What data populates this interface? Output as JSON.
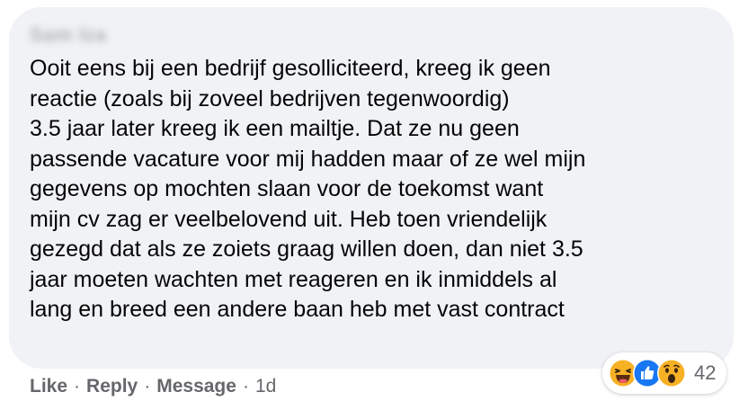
{
  "comment": {
    "author": "Sam Iza",
    "lines": [
      "Ooit eens bij een bedrijf gesolliciteerd, kreeg ik geen",
      "reactie (zoals bij zoveel bedrijven tegenwoordig)",
      "3.5 jaar later kreeg ik een mailtje. Dat ze nu geen",
      "passende vacature voor mij hadden maar of ze wel mijn",
      "gegevens op mochten slaan voor de toekomst want",
      "mijn cv zag er veelbelovend uit. Heb toen vriendelijk",
      "gezegd dat als ze zoiets graag willen doen, dan niet 3.5",
      "jaar moeten wachten met reageren en ik inmiddels al",
      "lang en breed een andere baan heb met vast contract"
    ]
  },
  "actions": {
    "like": "Like",
    "reply": "Reply",
    "message": "Message",
    "separator": "·",
    "time": "1d"
  },
  "reactions": {
    "icons": [
      "haha-icon",
      "like-icon",
      "wow-icon"
    ],
    "count": "42"
  },
  "colors": {
    "bubble": "#f0f2f5",
    "text": "#050505",
    "secondary": "#65676b",
    "like_blue": "#1877f2",
    "emoji_yellow": "#f7b125"
  }
}
